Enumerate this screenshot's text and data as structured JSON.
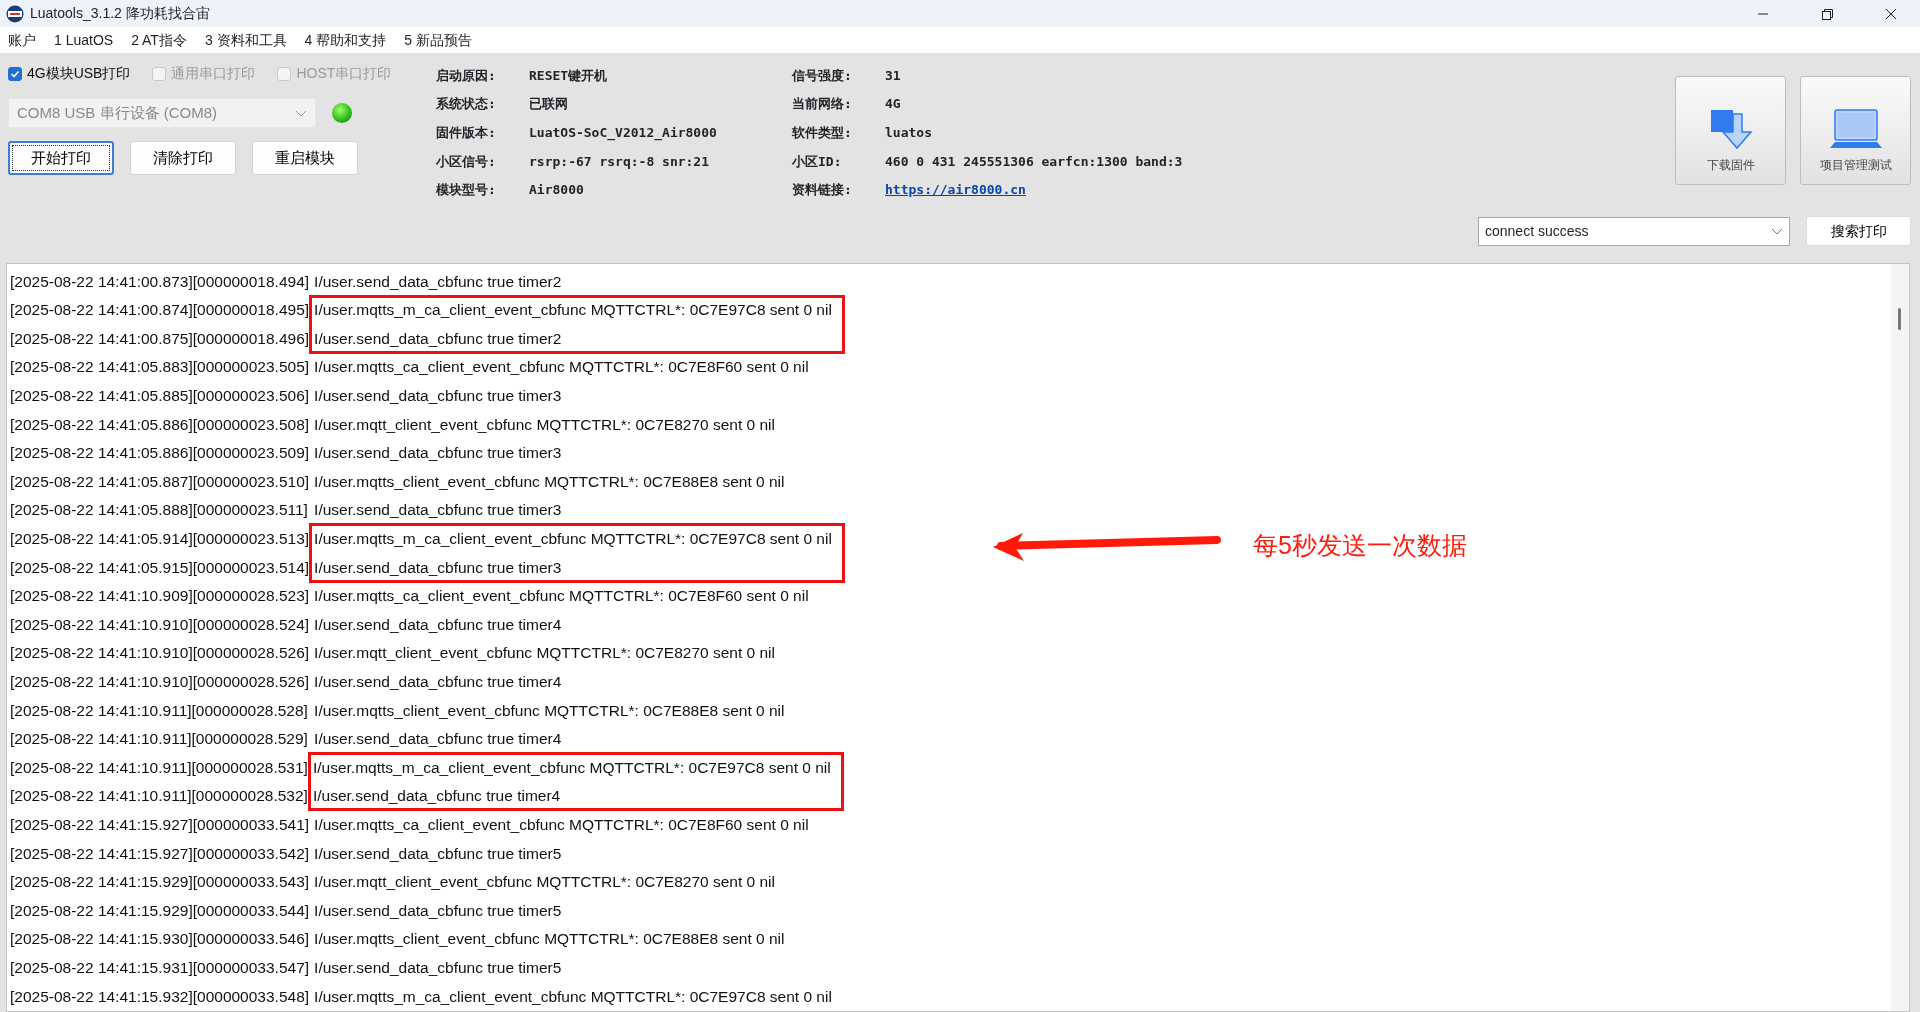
{
  "window": {
    "title": "Luatools_3.1.2 降功耗找合宙"
  },
  "menu": [
    "账户",
    "1 LuatOS",
    "2 AT指令",
    "3 资料和工具",
    "4 帮助和支持",
    "5 新品预告"
  ],
  "print_options": [
    {
      "label": "4G模块USB打印",
      "checked": true,
      "disabled": false
    },
    {
      "label": "通用串口打印",
      "checked": false,
      "disabled": true
    },
    {
      "label": "HOST串口打印",
      "checked": false,
      "disabled": true
    }
  ],
  "port": {
    "value": "COM8 USB 串行设备 (COM8)",
    "disabled": true,
    "connected": true
  },
  "actions": [
    {
      "label": "开始打印",
      "focused": true
    },
    {
      "label": "清除打印",
      "focused": false
    },
    {
      "label": "重启模块",
      "focused": false
    }
  ],
  "info": {
    "left": [
      {
        "label": "启动原因:",
        "value": "RESET键开机",
        "kind": "text"
      },
      {
        "label": "系统状态:",
        "value": "已联网",
        "kind": "text"
      },
      {
        "label": "固件版本:",
        "value": "LuatOS-SoC_V2012_Air8000",
        "kind": "text"
      },
      {
        "label": "小区信号:",
        "value": "rsrp:-67 rsrq:-8 snr:21",
        "kind": "text"
      },
      {
        "label": "模块型号:",
        "value": "Air8000",
        "kind": "text"
      }
    ],
    "right": [
      {
        "label": "信号强度:",
        "value": "31",
        "kind": "text"
      },
      {
        "label": "当前网络:",
        "value": "4G",
        "kind": "text"
      },
      {
        "label": "软件类型:",
        "value": "luatos",
        "kind": "text"
      },
      {
        "label": "小区ID:",
        "value": "460 0 431 245551306 earfcn:1300 band:3",
        "kind": "text"
      },
      {
        "label": "资料链接:",
        "value": "https://air8000.cn",
        "kind": "link"
      }
    ]
  },
  "tools": [
    {
      "label": "下载固件",
      "kind": "download"
    },
    {
      "label": "项目管理测试",
      "kind": "project"
    }
  ],
  "filter": {
    "value": "connect success"
  },
  "search_button": "搜索打印",
  "log": {
    "blocks": [
      {
        "highlighted": false,
        "rows": [
          {
            "prefix": "[2025-08-22 14:41:00.873][000000018.494]",
            "message": "I/user.send_data_cbfunc true timer2"
          }
        ]
      },
      {
        "highlighted": true,
        "rows": [
          {
            "prefix": "[2025-08-22 14:41:00.874][000000018.495]",
            "message": "I/user.mqtts_m_ca_client_event_cbfunc MQTTCTRL*: 0C7E97C8 sent 0 nil"
          },
          {
            "prefix": "[2025-08-22 14:41:00.875][000000018.496]",
            "message": "I/user.send_data_cbfunc true timer2"
          }
        ]
      },
      {
        "highlighted": false,
        "rows": [
          {
            "prefix": "[2025-08-22 14:41:05.883][000000023.505]",
            "message": "I/user.mqtts_ca_client_event_cbfunc MQTTCTRL*: 0C7E8F60 sent 0 nil"
          },
          {
            "prefix": "[2025-08-22 14:41:05.885][000000023.506]",
            "message": "I/user.send_data_cbfunc true timer3"
          },
          {
            "prefix": "[2025-08-22 14:41:05.886][000000023.508]",
            "message": "I/user.mqtt_client_event_cbfunc MQTTCTRL*: 0C7E8270 sent 0 nil"
          },
          {
            "prefix": "[2025-08-22 14:41:05.886][000000023.509]",
            "message": "I/user.send_data_cbfunc true timer3"
          },
          {
            "prefix": "[2025-08-22 14:41:05.887][000000023.510]",
            "message": "I/user.mqtts_client_event_cbfunc MQTTCTRL*: 0C7E88E8 sent 0 nil"
          },
          {
            "prefix": "[2025-08-22 14:41:05.888][000000023.511]",
            "message": "I/user.send_data_cbfunc true timer3"
          }
        ]
      },
      {
        "highlighted": true,
        "rows": [
          {
            "prefix": "[2025-08-22 14:41:05.914][000000023.513]",
            "message": "I/user.mqtts_m_ca_client_event_cbfunc MQTTCTRL*: 0C7E97C8 sent 0 nil"
          },
          {
            "prefix": "[2025-08-22 14:41:05.915][000000023.514]",
            "message": "I/user.send_data_cbfunc true timer3"
          }
        ]
      },
      {
        "highlighted": false,
        "rows": [
          {
            "prefix": "[2025-08-22 14:41:10.909][000000028.523]",
            "message": "I/user.mqtts_ca_client_event_cbfunc MQTTCTRL*: 0C7E8F60 sent 0 nil"
          },
          {
            "prefix": "[2025-08-22 14:41:10.910][000000028.524]",
            "message": "I/user.send_data_cbfunc true timer4"
          },
          {
            "prefix": "[2025-08-22 14:41:10.910][000000028.526]",
            "message": "I/user.mqtt_client_event_cbfunc MQTTCTRL*: 0C7E8270 sent 0 nil"
          },
          {
            "prefix": "[2025-08-22 14:41:10.910][000000028.526]",
            "message": "I/user.send_data_cbfunc true timer4"
          },
          {
            "prefix": "[2025-08-22 14:41:10.911][000000028.528]",
            "message": "I/user.mqtts_client_event_cbfunc MQTTCTRL*: 0C7E88E8 sent 0 nil"
          },
          {
            "prefix": "[2025-08-22 14:41:10.911][000000028.529]",
            "message": "I/user.send_data_cbfunc true timer4"
          }
        ]
      },
      {
        "highlighted": true,
        "rows": [
          {
            "prefix": "[2025-08-22 14:41:10.911][000000028.531]",
            "message": "I/user.mqtts_m_ca_client_event_cbfunc MQTTCTRL*: 0C7E97C8 sent 0 nil"
          },
          {
            "prefix": "[2025-08-22 14:41:10.911][000000028.532]",
            "message": "I/user.send_data_cbfunc true timer4"
          }
        ]
      },
      {
        "highlighted": false,
        "rows": [
          {
            "prefix": "[2025-08-22 14:41:15.927][000000033.541]",
            "message": "I/user.mqtts_ca_client_event_cbfunc MQTTCTRL*: 0C7E8F60 sent 0 nil"
          },
          {
            "prefix": "[2025-08-22 14:41:15.927][000000033.542]",
            "message": "I/user.send_data_cbfunc true timer5"
          },
          {
            "prefix": "[2025-08-22 14:41:15.929][000000033.543]",
            "message": "I/user.mqtt_client_event_cbfunc MQTTCTRL*: 0C7E8270 sent 0 nil"
          },
          {
            "prefix": "[2025-08-22 14:41:15.929][000000033.544]",
            "message": "I/user.send_data_cbfunc true timer5"
          },
          {
            "prefix": "[2025-08-22 14:41:15.930][000000033.546]",
            "message": "I/user.mqtts_client_event_cbfunc MQTTCTRL*: 0C7E88E8 sent 0 nil"
          },
          {
            "prefix": "[2025-08-22 14:41:15.931][000000033.547]",
            "message": "I/user.send_data_cbfunc true timer5"
          },
          {
            "prefix": "[2025-08-22 14:41:15.932][000000033.548]",
            "message": "I/user.mqtts_m_ca_client_event_cbfunc MQTTCTRL*: 0C7E97C8 sent 0 nil"
          }
        ]
      }
    ]
  },
  "annotation": {
    "text": "每5秒发送一次数据"
  }
}
